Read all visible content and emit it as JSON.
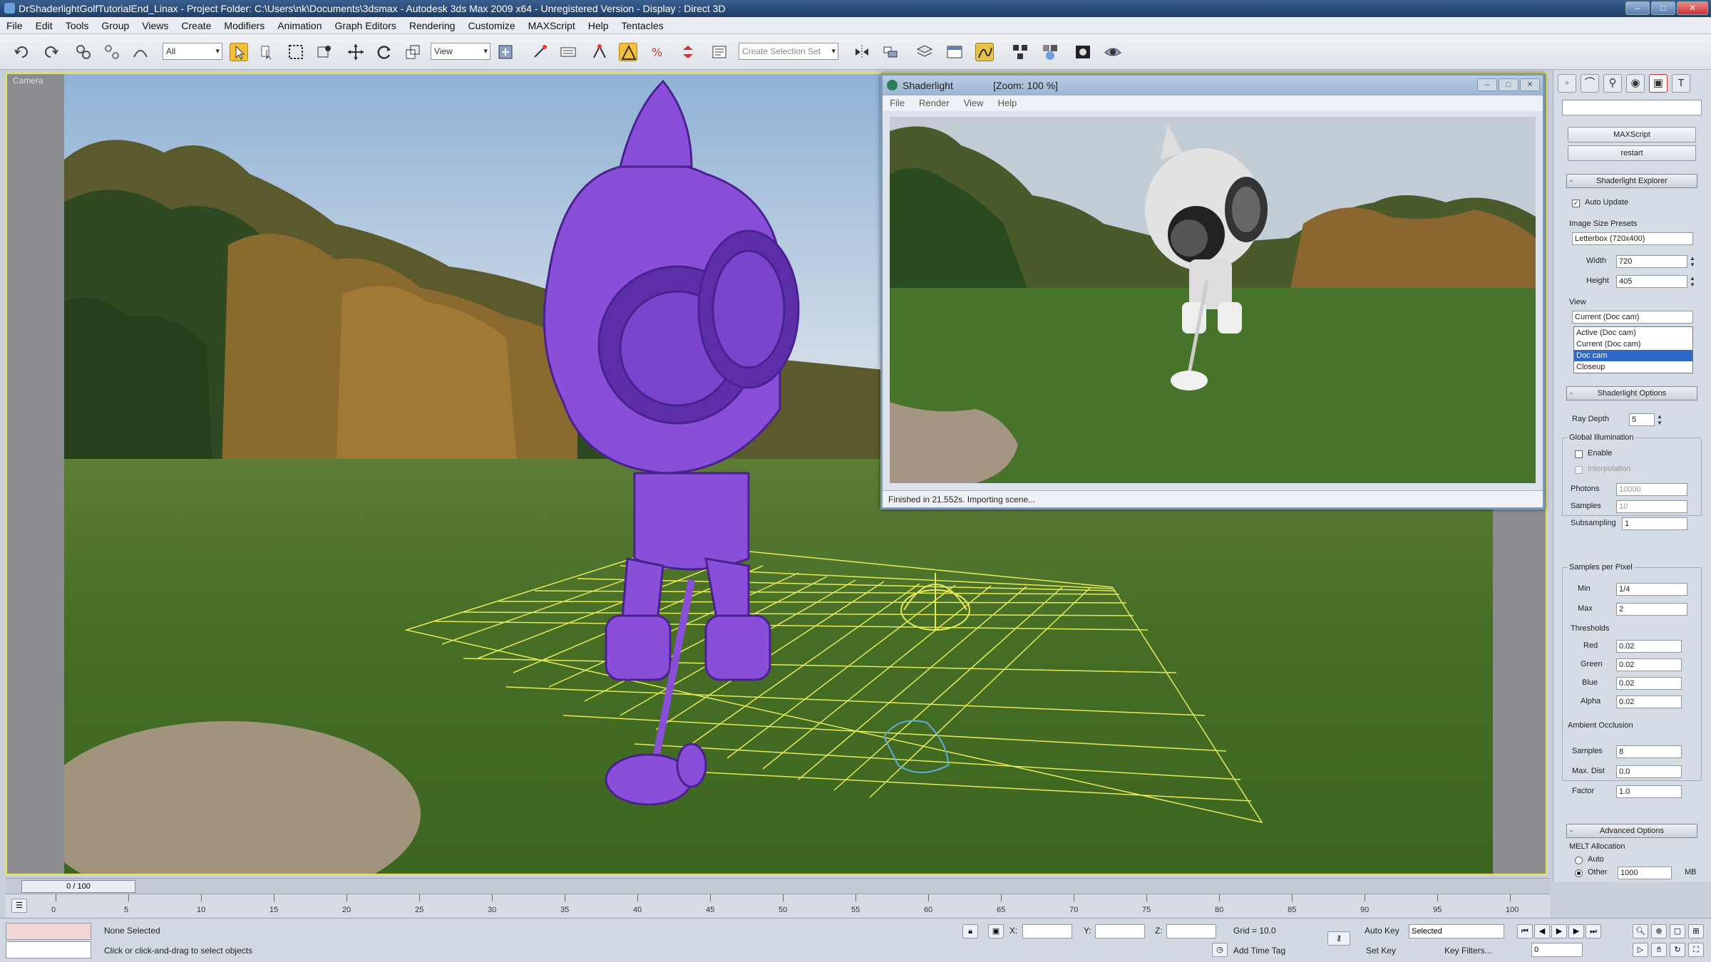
{
  "window": {
    "title": "DrShaderlightGolfTutorialEnd_Linax      - Project Folder: C:\\Users\\nk\\Documents\\3dsmax      - Autodesk 3ds Max  2009 x64    - Unregistered Version      - Display : Direct 3D",
    "buttons": [
      "–",
      "□",
      "✕"
    ]
  },
  "menu": [
    "File",
    "Edit",
    "Tools",
    "Group",
    "Views",
    "Create",
    "Modifiers",
    "Animation",
    "Graph Editors",
    "Rendering",
    "Customize",
    "MAXScript",
    "Help",
    "Tentacles"
  ],
  "toolbar": {
    "selection_filter": "All",
    "reference_coord": "View",
    "named_selection": "Create Selection Set"
  },
  "viewport": {
    "label": "Camera"
  },
  "shaderlight": {
    "title": "Shaderlight",
    "zoom": "[Zoom: 100 %]",
    "menu": [
      "File",
      "Render",
      "View",
      "Help"
    ],
    "status": "Finished in 21.552s. Importing scene..."
  },
  "command_panel": {
    "tabs": [
      "◦",
      "⌒",
      "⚲",
      "◉",
      "▣",
      "T"
    ],
    "search_value": "",
    "buttons": [
      "MAXScript",
      "restart"
    ],
    "rollouts": {
      "setup": "Shaderlight Explorer",
      "options": "Shaderlight Options",
      "advanced": "Advanced Options"
    },
    "auto_update": "Auto Update",
    "image_size_preset_label": "Image Size Presets",
    "image_size_preset_value": "Letterbox (720x400)",
    "width_label": "Width",
    "width_value": "720",
    "height_label": "Height",
    "height_value": "405",
    "view_label": "View",
    "view_value": "Current (Doc cam)",
    "view_options": [
      "Active (Doc cam)",
      "Current (Doc cam)",
      "Doc cam",
      "Closeup"
    ],
    "ray_depth_label": "Ray Depth",
    "ray_depth_value": "5",
    "gi_label": "Global Illumination",
    "gi_enable": "Enable",
    "gi_sub": "Interpolation",
    "photons_label": "Photons",
    "photons_value": "10000",
    "samples_label": "Samples",
    "samples_value": "10",
    "subsampling_label": "Subsampling",
    "subsampling_value": "1",
    "spp_label": "Samples per Pixel",
    "spp_min_label": "Min",
    "spp_min_value": "1/4",
    "spp_max_label": "Max",
    "spp_max_value": "2",
    "thresholds_label": "Thresholds",
    "red_label": "Red",
    "red_value": "0.02",
    "green_label": "Green",
    "green_value": "0.02",
    "blue_label": "Blue",
    "blue_value": "0.02",
    "alpha_label": "Alpha",
    "alpha_value": "0.02",
    "ao_label": "Ambient Occlusion",
    "ao_samples_label": "Samples",
    "ao_samples_value": "8",
    "ao_maxdist_label": "Max. Dist",
    "ao_maxdist_value": "0.0",
    "ao_factor_label": "Factor",
    "ao_factor_value": "1.0",
    "mem_label": "MELT Allocation",
    "mem_auto": "Auto",
    "mem_other": "Other",
    "mem_other_value": "1000",
    "mem_unit": "MB"
  },
  "timeline": {
    "slider": "0 / 100",
    "ticks": [
      "0",
      "5",
      "10",
      "15",
      "20",
      "25",
      "30",
      "35",
      "40",
      "45",
      "50",
      "55",
      "60",
      "65",
      "70",
      "75",
      "80",
      "85",
      "90",
      "95",
      "100"
    ]
  },
  "status": {
    "selection": "None Selected",
    "prompt": "Click or click-and-drag to select objects",
    "x_label": "X:",
    "y_label": "Y:",
    "z_label": "Z:",
    "grid": "Grid = 10.0",
    "add_time_tag": "Add Time Tag",
    "auto_key": "Auto Key",
    "set_key": "Set Key",
    "key_mode": "Selected",
    "key_filters": "Key Filters...",
    "frame": "0"
  },
  "colors": {
    "viewport_border": "#e4e64a",
    "robot_purple": "#8a4fd8",
    "grid_yellow": "#e6ea5a",
    "selection_blue": "#3168c6"
  }
}
